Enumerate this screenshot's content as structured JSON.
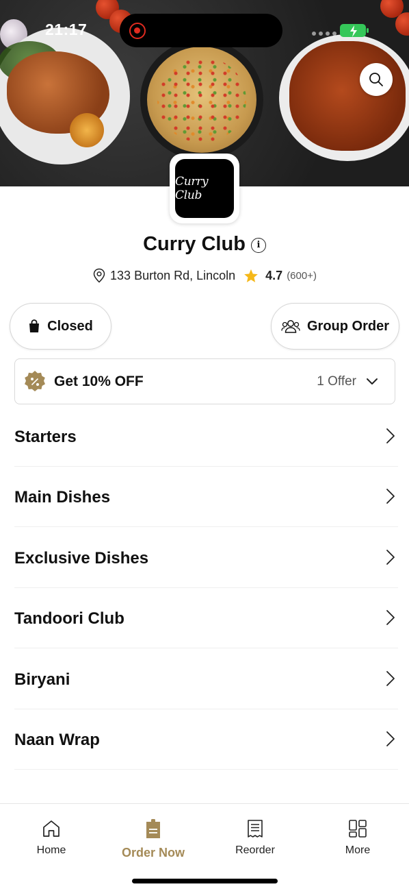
{
  "status_bar": {
    "time": "21:17"
  },
  "restaurant": {
    "logo_text": "Curry Club",
    "name": "Curry Club",
    "address": "133 Burton Rd, Lincoln",
    "rating": "4.7",
    "rating_count": "(600+)"
  },
  "actions": {
    "closed_label": "Closed",
    "group_order_label": "Group Order"
  },
  "offer": {
    "title": "Get 10% OFF",
    "count": "1 Offer",
    "badge_color": "#a48a57"
  },
  "menu": {
    "items": [
      {
        "label": "Starters"
      },
      {
        "label": "Main Dishes"
      },
      {
        "label": "Exclusive Dishes"
      },
      {
        "label": "Tandoori Club"
      },
      {
        "label": "Biryani"
      },
      {
        "label": "Naan Wrap"
      }
    ]
  },
  "tabbar": {
    "home": "Home",
    "order_now": "Order Now",
    "reorder": "Reorder",
    "more": "More",
    "active": "order_now",
    "accent": "#a48a57"
  }
}
